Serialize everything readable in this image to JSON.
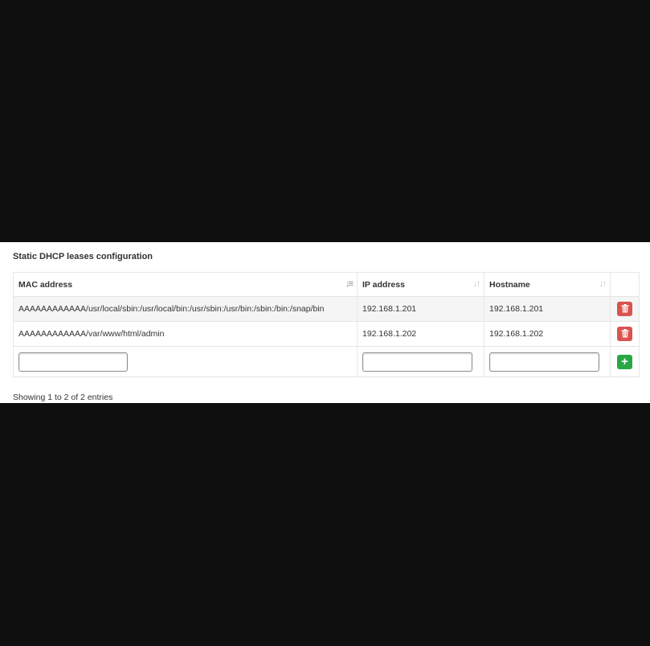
{
  "panel": {
    "title": "Static DHCP leases configuration"
  },
  "table": {
    "columns": [
      {
        "label": "MAC address",
        "sort_icon": "sort-amount-asc-icon"
      },
      {
        "label": "IP address",
        "sort_icon": "sort-icon"
      },
      {
        "label": "Hostname",
        "sort_icon": "sort-icon"
      }
    ],
    "rows": [
      {
        "mac": "AAAAAAAAAAAA/usr/local/sbin:/usr/local/bin:/usr/sbin:/usr/bin:/sbin:/bin:/snap/bin",
        "ip": "192.168.1.201",
        "hostname": "192.168.1.201",
        "action_icon": "trash-icon"
      },
      {
        "mac": "AAAAAAAAAAAA/var/www/html/admin",
        "ip": "192.168.1.202",
        "hostname": "192.168.1.202",
        "action_icon": "trash-icon"
      }
    ],
    "new_entry": {
      "mac_value": "",
      "ip_value": "",
      "hostname_value": "",
      "action_icon": "plus-icon"
    }
  },
  "footer": {
    "info": "Showing 1 to 2 of 2 entries"
  },
  "colors": {
    "delete_button": "#d9534f",
    "add_button": "#28a745",
    "page_background": "#0f0f0f"
  }
}
